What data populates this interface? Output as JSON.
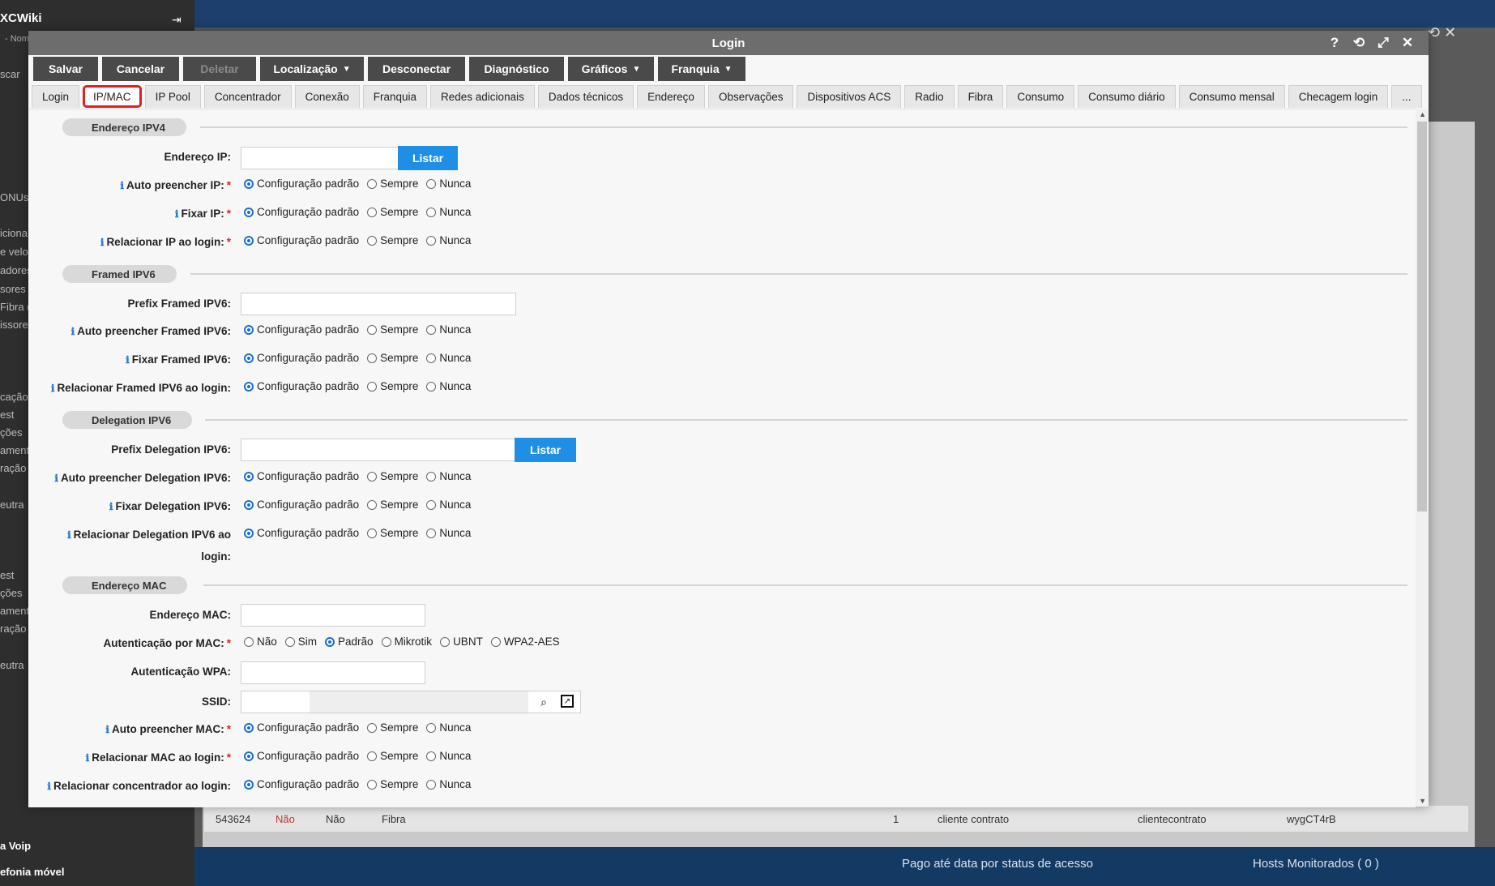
{
  "background": {
    "brand": "XCWiki",
    "brand_sub": "- Nom",
    "search_label": "scar",
    "menu": [
      "ONUs",
      "icional",
      "e veloc",
      "adores",
      "sores",
      "Fibra (",
      "issores",
      "cação",
      "est",
      "ções",
      "amento",
      "ração",
      "eutra",
      "est",
      "ções",
      "amento",
      "ração",
      "eutra"
    ],
    "bottom_menu": [
      "a Voip",
      "efonia móvel"
    ],
    "table_row": {
      "id": "543624",
      "col2": "Não",
      "col3": "Não",
      "col4": "Fibra",
      "col5": "1",
      "col6": "cliente contrato",
      "col7": "clientecontrato",
      "col8": "wygCT4rB"
    },
    "cards": [
      "Pago até data por status de acesso",
      "Hosts Monitorados ( 0 )"
    ]
  },
  "modal": {
    "title": "Login",
    "window_icons": [
      "?",
      "⟲",
      "⤢",
      "✕"
    ]
  },
  "toolbar": [
    {
      "label": "Salvar",
      "disabled": false,
      "dropdown": false
    },
    {
      "label": "Cancelar",
      "disabled": false,
      "dropdown": false
    },
    {
      "label": "Deletar",
      "disabled": true,
      "dropdown": false
    },
    {
      "label": "Localização",
      "disabled": false,
      "dropdown": true
    },
    {
      "label": "Desconectar",
      "disabled": false,
      "dropdown": false
    },
    {
      "label": "Diagnóstico",
      "disabled": false,
      "dropdown": false
    },
    {
      "label": "Gráficos",
      "disabled": false,
      "dropdown": true
    },
    {
      "label": "Franquia",
      "disabled": false,
      "dropdown": true
    }
  ],
  "tabs": [
    "Login",
    "IP/MAC",
    "IP Pool",
    "Concentrador",
    "Conexão",
    "Franquia",
    "Redes adicionais",
    "Dados técnicos",
    "Endereço",
    "Observações",
    "Dispositivos ACS",
    "Radio",
    "Fibra",
    "Consumo",
    "Consumo diário",
    "Consumo mensal",
    "Checagem login",
    "..."
  ],
  "active_tab": "IP/MAC",
  "radio_options": [
    "Configuração padrão",
    "Sempre",
    "Nunca"
  ],
  "sections": {
    "ipv4": {
      "title": "Endereço IPV4",
      "endereco_ip": "Endereço IP:",
      "listar": "Listar",
      "auto_preencher_ip": "Auto preencher IP:",
      "fixar_ip": "Fixar IP:",
      "relacionar_ip": "Relacionar IP ao login:"
    },
    "framed": {
      "title": "Framed IPV6",
      "prefix": "Prefix Framed IPV6:",
      "auto": "Auto preencher Framed IPV6:",
      "fixar": "Fixar Framed IPV6:",
      "relacionar": "Relacionar Framed IPV6 ao login:"
    },
    "delegation": {
      "title": "Delegation IPV6",
      "prefix": "Prefix Delegation IPV6:",
      "listar": "Listar",
      "auto": "Auto preencher Delegation IPV6:",
      "fixar": "Fixar Delegation IPV6:",
      "relacionar_1": "Relacionar Delegation IPV6 ao",
      "relacionar_2": "login:"
    },
    "mac": {
      "title": "Endereço MAC",
      "endereco_mac": "Endereço MAC:",
      "autenticacao_mac": "Autenticação por MAC:",
      "mac_options": [
        "Não",
        "Sim",
        "Padrão",
        "Mikrotik",
        "UBNT",
        "WPA2-AES"
      ],
      "mac_selected": "Padrão",
      "autenticacao_wpa": "Autenticação WPA:",
      "ssid": "SSID:",
      "auto_mac": "Auto preencher MAC:",
      "relacionar_mac": "Relacionar MAC ao login:",
      "relacionar_conc": "Relacionar concentrador ao login:"
    }
  }
}
